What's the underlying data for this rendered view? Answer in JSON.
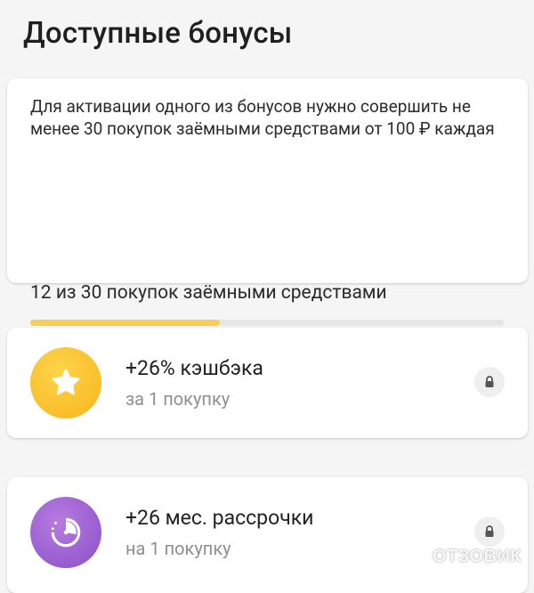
{
  "page": {
    "title": "Доступные бонусы"
  },
  "info": {
    "text": "Для активации одного из бонусов нужно совершить не менее 30 покупок заёмными средствами от 100 ₽ каждая",
    "progress_label": "12 из 30 покупок заёмными средствами",
    "progress_current": 12,
    "progress_total": 30,
    "progress_color": "#f6cd55"
  },
  "bonuses": [
    {
      "title": "+26% кэшбэка",
      "subtitle": "за 1 покупку",
      "icon": "star-icon",
      "icon_color": "#f6b41c",
      "locked": true
    },
    {
      "title": "+26 мес. рассрочки",
      "subtitle": "на 1 покупку",
      "icon": "timer-icon",
      "icon_color": "#8a4fc8",
      "locked": true
    }
  ],
  "watermark": {
    "text": "ОТЗОВИК"
  }
}
